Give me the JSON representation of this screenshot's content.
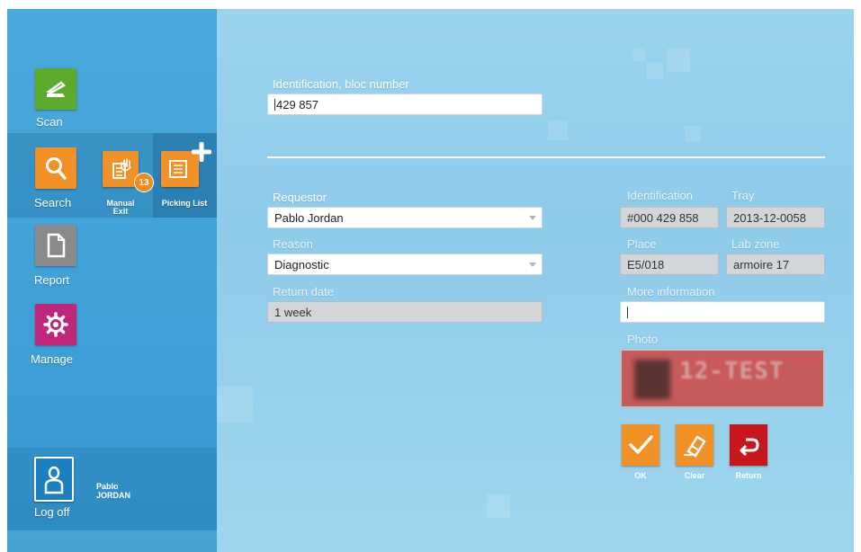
{
  "nav": {
    "scan": {
      "label": "Scan",
      "icon": "scanner-icon",
      "color": "#5cab2c"
    },
    "search": {
      "label": "Search",
      "icon": "magnifier-icon",
      "color": "#f29125"
    },
    "manual_exit": {
      "label": "Manual Exit",
      "icon": "manual-exit-icon",
      "badge": "13",
      "color": "#f29125"
    },
    "picking_list": {
      "label": "Picking List",
      "icon": "picking-list-icon",
      "color": "#f29125"
    },
    "report": {
      "label": "Report",
      "icon": "document-icon",
      "color": "#8a8a8a"
    },
    "manage": {
      "label": "Manage",
      "icon": "gear-icon",
      "color": "#c0267a"
    },
    "logoff": {
      "label": "Log off",
      "icon": "user-icon",
      "color": "#1b7fc1"
    },
    "user": {
      "first": "Pablo",
      "last": "JORDAN"
    }
  },
  "form": {
    "identification_bloc": {
      "label": "Identification, bloc number",
      "value": "429 857"
    },
    "requestor": {
      "label": "Requestor",
      "value": "Pablo Jordan"
    },
    "reason": {
      "label": "Reason",
      "value": "Diagnostic"
    },
    "return_date": {
      "label": "Return date",
      "value": "1 week"
    },
    "identification": {
      "label": "Identification",
      "value": "#000 429 858"
    },
    "tray": {
      "label": "Tray",
      "value": "2013-12-0058"
    },
    "place": {
      "label": "Place",
      "value": "E5/018"
    },
    "lab_zone": {
      "label": "Lab zone",
      "value": "armoire 17"
    },
    "more_information": {
      "label": "More information",
      "value": ""
    },
    "photo": {
      "label": "Photo",
      "text": "12-TEST"
    }
  },
  "actions": {
    "ok": {
      "label": "OK",
      "icon": "checkmark-icon",
      "color": "#f29125"
    },
    "clear": {
      "label": "Clear",
      "icon": "eraser-icon",
      "color": "#f29125"
    },
    "return": {
      "label": "Return",
      "icon": "return-arrow-icon",
      "color": "#c8161d"
    }
  }
}
